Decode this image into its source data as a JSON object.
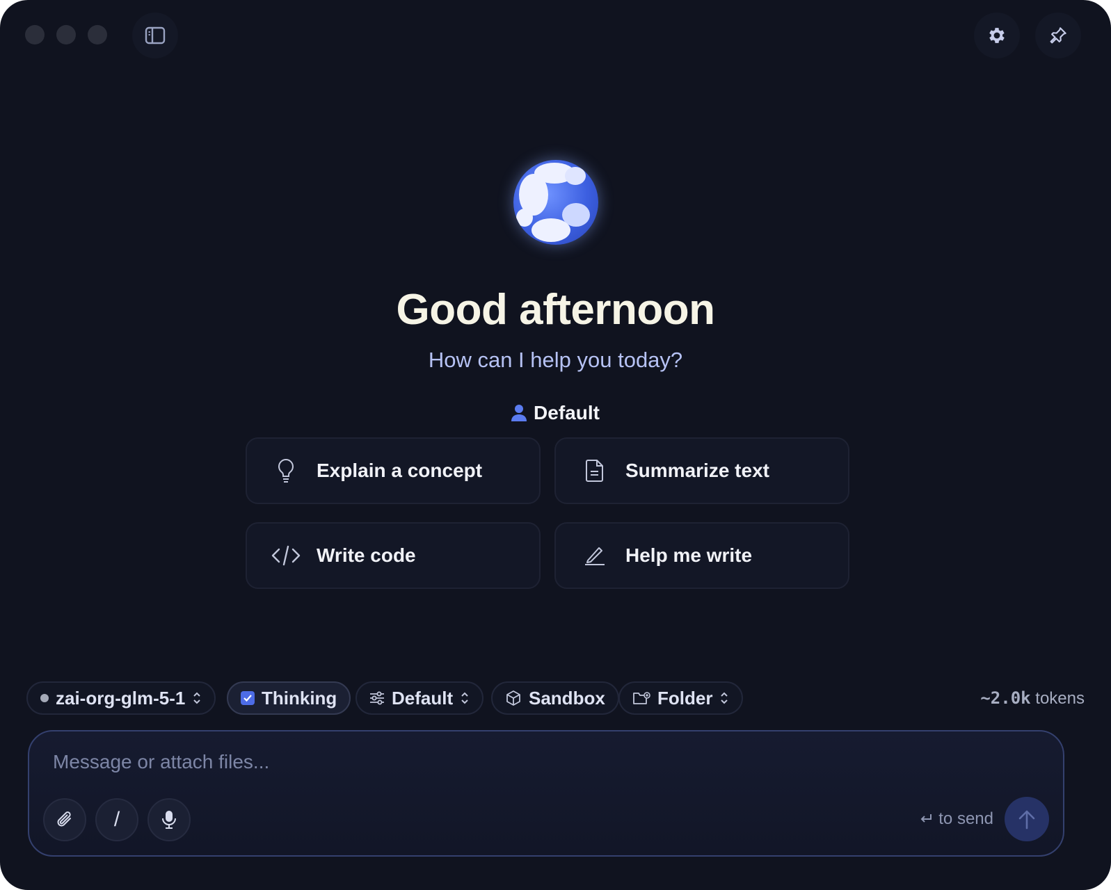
{
  "titlebar": {
    "sidebar_icon": "sidebar-toggle-icon",
    "settings_icon": "gear-icon",
    "pin_icon": "pin-icon"
  },
  "hero": {
    "greeting": "Good afternoon",
    "subtitle": "How can I help you today?",
    "profile_icon": "user-icon",
    "profile_label": "Default"
  },
  "suggestions": [
    {
      "icon": "lightbulb-icon",
      "label": "Explain a concept"
    },
    {
      "icon": "document-icon",
      "label": "Summarize text"
    },
    {
      "icon": "code-icon",
      "label": "Write code"
    },
    {
      "icon": "pen-icon",
      "label": "Help me write"
    }
  ],
  "toolbar": {
    "model": "zai-org-glm-5-1",
    "thinking": "Thinking",
    "thinking_checked": true,
    "preset": "Default",
    "sandbox": "Sandbox",
    "folder": "Folder",
    "tokens_value": "~2.0k",
    "tokens_label": "tokens"
  },
  "composer": {
    "placeholder": "Message or attach files...",
    "value": "",
    "slash_label": "/",
    "send_hint_icon": "return-icon",
    "send_hint": "to send",
    "send_icon": "arrow-up-icon"
  },
  "colors": {
    "background": "#10131f",
    "accent": "#4d6ce6",
    "title": "#f6f4e6",
    "subtitle": "#b6c2f4"
  }
}
